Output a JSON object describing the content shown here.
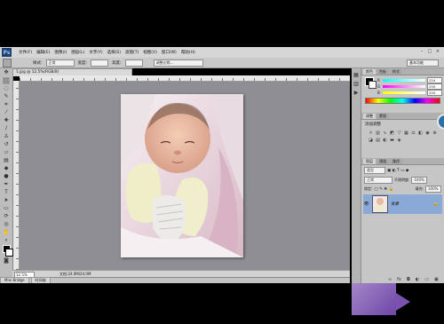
{
  "app": {
    "logo": "Ps",
    "menu": [
      "文件(F)",
      "编辑(E)",
      "图像(I)",
      "图层(L)",
      "文字(Y)",
      "选择(S)",
      "滤镜(T)",
      "视图(V)",
      "窗口(W)",
      "帮助(H)"
    ],
    "window_controls": [
      "–",
      "□",
      "×"
    ]
  },
  "options_bar": {
    "style_label": "样式:",
    "style_value": "正常",
    "width_label": "宽度:",
    "height_label": "高度:",
    "refine_edge_label": "调整边缘...",
    "workspace": "基本功能"
  },
  "document": {
    "tab_title": "1.jpg @ 12.5%(RGB/8)",
    "zoom": "12.5%",
    "doc_size": "文档:24.0M/24.0M"
  },
  "mini_bridge": {
    "tabs": [
      "Mini Bridge",
      "时间轴"
    ]
  },
  "color_panel": {
    "tabs": [
      "颜色",
      "色板",
      "样式"
    ],
    "sliders": [
      {
        "label": "R",
        "value": "254",
        "color_from": "#00ffff",
        "color_to": "#ffffff"
      },
      {
        "label": "G",
        "value": "250",
        "color_from": "#ff00ff",
        "color_to": "#ffffff"
      },
      {
        "label": "B",
        "value": "250",
        "color_from": "#ffff00",
        "color_to": "#ffffff"
      }
    ]
  },
  "adjustments_panel": {
    "tabs": [
      "调整",
      "蒙版"
    ],
    "title": "添加调整"
  },
  "layers_panel": {
    "tabs": [
      "图层",
      "通道",
      "路径"
    ],
    "kind_label": "类型",
    "blend_mode": "正常",
    "opacity_label": "不透明度:",
    "opacity_value": "100%",
    "lock_label": "锁定:",
    "fill_label": "填充:",
    "fill_value": "100%",
    "layer_name": "背景"
  },
  "colors": {
    "canvas_bg": "#8f8f93",
    "selected_layer": "#8aa9d6",
    "swatch_purple": "#8a60b8"
  }
}
